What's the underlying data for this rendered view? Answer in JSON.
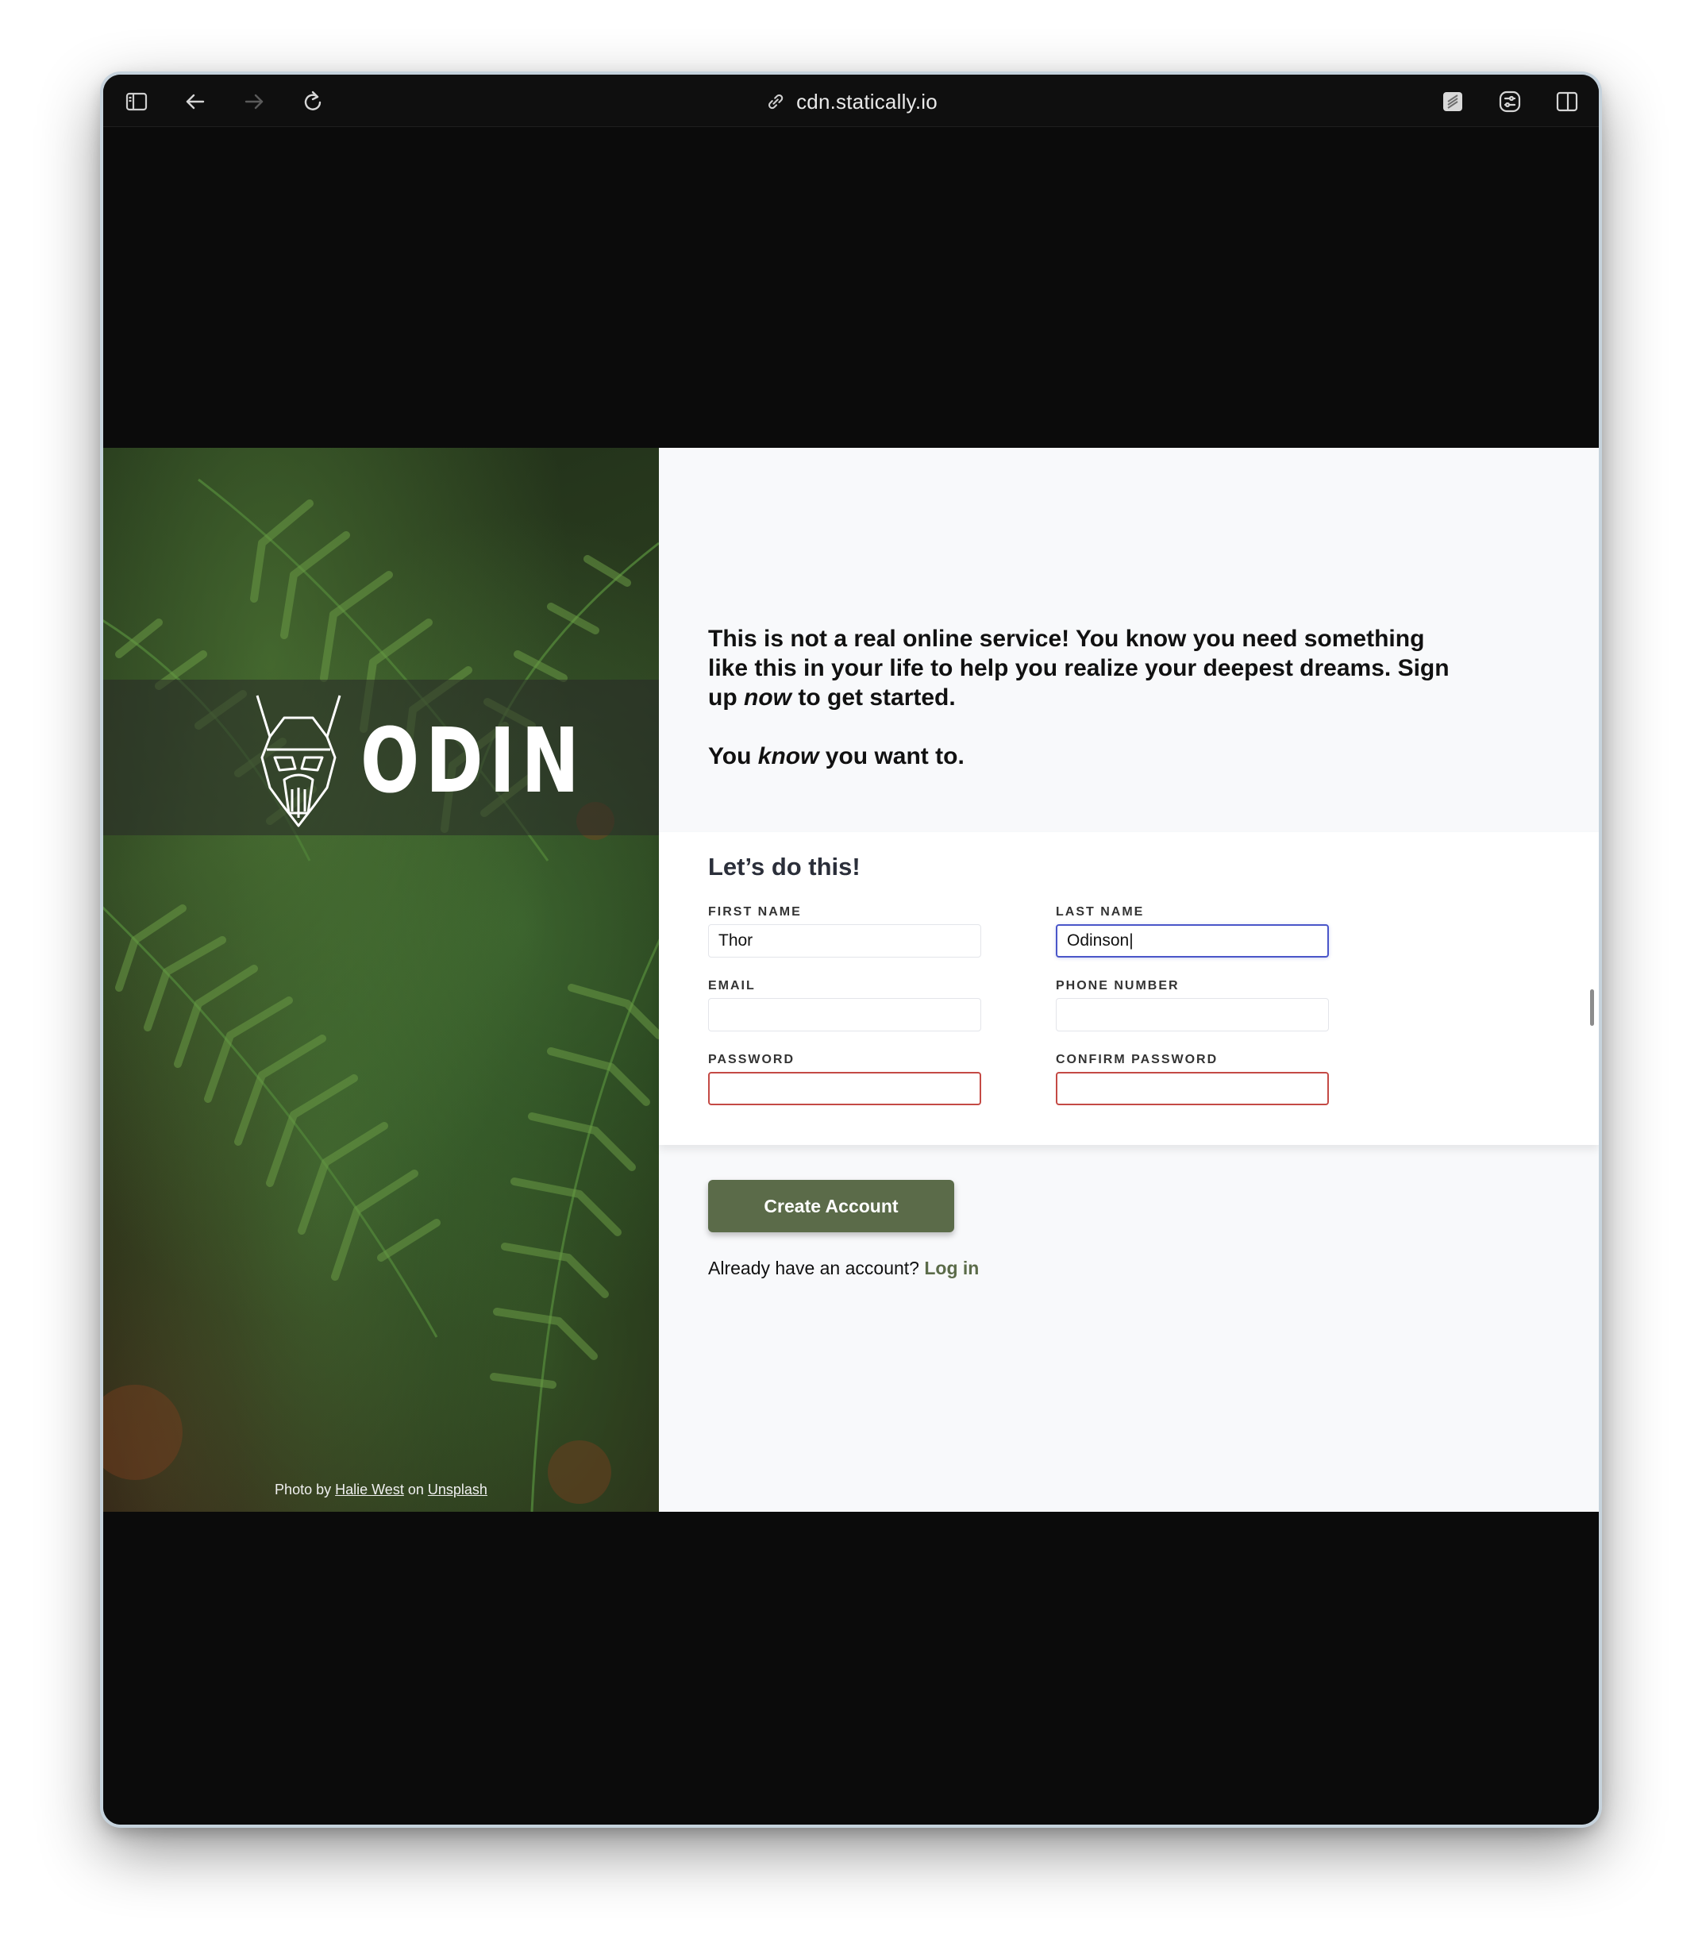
{
  "browser": {
    "url": "cdn.statically.io"
  },
  "hero": {
    "logo_text": "ODIN",
    "credit_prefix": "Photo by",
    "credit_author": "Halie West",
    "credit_mid": "on",
    "credit_site": "Unsplash"
  },
  "intro": {
    "line1_a": "This is not a real online service! You know you need something like this in your life to help you realize your deepest dreams. Sign up",
    "line1_em": "now",
    "line1_b": "to get started.",
    "line2_a": "You",
    "line2_em": "know",
    "line2_b": "you want to."
  },
  "form": {
    "title": "Let’s do this!",
    "first_name_label": "FIRST NAME",
    "first_name_value": "Thor",
    "last_name_label": "LAST NAME",
    "last_name_value": "Odinson|",
    "email_label": "EMAIL",
    "email_value": "",
    "phone_label": "PHONE NUMBER",
    "phone_value": "",
    "password_label": "PASSWORD",
    "password_value": "",
    "confirm_label": "CONFIRM PASSWORD",
    "confirm_value": ""
  },
  "actions": {
    "create_label": "Create Account",
    "login_prompt": "Already have an account?",
    "login_link": "Log in"
  },
  "colors": {
    "accent": "#5b6b49",
    "focus": "#4a56c9",
    "error": "#c44a45"
  }
}
